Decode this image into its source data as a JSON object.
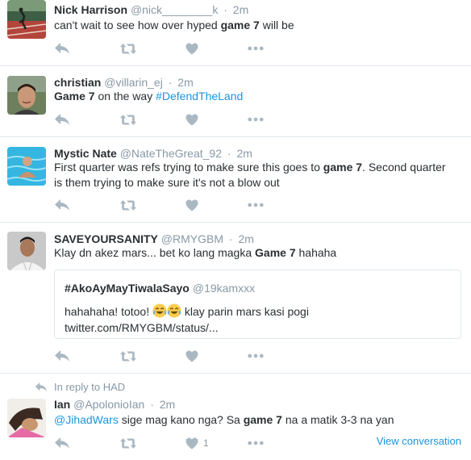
{
  "colors": {
    "name": "#292f33",
    "muted": "#8899a6",
    "link": "#1b95e0",
    "border": "#e1e8ed"
  },
  "icons": [
    "reply-icon",
    "retweet-icon",
    "like-icon",
    "more-icon",
    "emoji-tears-of-joy-icon"
  ],
  "tweets": [
    {
      "name": "Nick Harrison",
      "handle": "@nick________k",
      "time": "2m",
      "text_a": "can't wait to see how over hyped ",
      "bold": "game 7",
      "text_b": " will be"
    },
    {
      "name": "christian",
      "handle": "@villarin_ej",
      "time": "2m",
      "bold": "Game 7",
      "text_a": " on the way ",
      "hashtag": "#DefendTheLand"
    },
    {
      "name": "Mystic Nate",
      "handle": "@NateTheGreat_92",
      "time": "2m",
      "line1_a": "First quarter was refs trying to make sure this goes to ",
      "bold": "game 7",
      "line1_b": ". Second quarter",
      "line2": "is them trying to make sure it's not a blow out"
    },
    {
      "name": "SAVEYOURSANITY",
      "handle": "@RMYGBM",
      "time": "2m",
      "text_a": "Klay dn akez mars... bet ko lang magka ",
      "bold": "Game 7",
      "text_b": " hahaha",
      "quote": {
        "name": "#AkoAyMayTiwalaSayo",
        "handle": "@19kamxxx",
        "text_a": "hahahaha! totoo! ",
        "text_b": " klay parin mars kasi pogi",
        "url": "twitter.com/RMYGBM/status/..."
      }
    },
    {
      "reply_to": "In reply to HAD",
      "name": "Ian",
      "handle": "@ApolonioIan",
      "time": "2m",
      "mention": "@JihadWars",
      "text_a": " sige mag kano nga? Sa ",
      "bold": "game 7",
      "text_b": " na a matik 3-3 na yan",
      "like_count": "1",
      "view_conversation": "View conversation"
    }
  ]
}
